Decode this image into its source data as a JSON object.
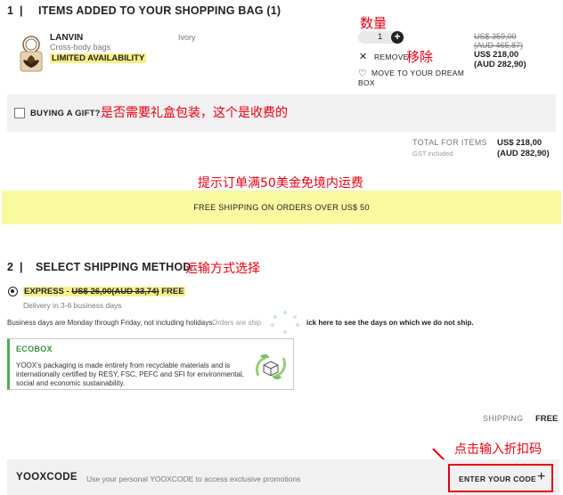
{
  "cart": {
    "step": "1",
    "separator": "|",
    "title": "ITEMS ADDED TO YOUR SHOPPING BAG (1)",
    "item": {
      "brand": "LANVIN",
      "category": "Cross-body bags",
      "color": "Ivory",
      "badge": "LIMITED AVAILABILITY",
      "quantity": "1",
      "remove_label": "REMOVE",
      "move_label": "MOVE TO YOUR DREAM BOX",
      "price_old_usd": "US$ 359,00",
      "price_old_aud": "(AUD 465,87)",
      "price_usd": "US$ 218,00",
      "price_aud": "(AUD 282,90)"
    },
    "gift_label": "BUYING A GIFT?",
    "total_label": "TOTAL FOR ITEMS",
    "total_usd": "US$ 218,00",
    "total_aud": "(AUD 282,90)",
    "gst_note": "GST included"
  },
  "annotations": {
    "quantity": "数量",
    "remove": "移除",
    "gift": "是否需要礼盒包装，这个是收费的",
    "shipping_banner": "提示订单满50美金免境内运费",
    "shipping_method": "运输方式选择",
    "promo": "点击输入折扣码"
  },
  "banner": {
    "text": "FREE SHIPPING ON ORDERS OVER US$ 50"
  },
  "shipping": {
    "step": "2",
    "separator": "|",
    "title": "SELECT SHIPPING METHOD",
    "option_name": "EXPRESS -",
    "option_old_price": "US$ 26,00(AUD 33,74)",
    "option_free": "FREE",
    "delivery": "Delivery in 3-6 business days",
    "note_start": "Business days are Monday through Friday, not including holidays.",
    "note_mid": "Orders are ship",
    "note_link": "ick here to see the days on which we do not ship.",
    "ecobox_title": "ECOBOX",
    "ecobox_text": "YOOX's packaging is made entirely from recyclable materials and is internationally certified by RESY, FSC, PEFC and SFI for environmental, social and economic sustainability.",
    "summary_label": "SHIPPING",
    "summary_value": "FREE"
  },
  "promo": {
    "title": "YOOXCODE",
    "text": "Use your personal YOOXCODE to access exclusive promotions",
    "button": "ENTER YOUR CODE",
    "plus": "+"
  },
  "colors": {
    "annotation_red": "#e60012",
    "highlight_yellow": "#f7f08a",
    "banner_yellow": "#f9f9a0",
    "panel_gray": "#f1f1f1",
    "eco_green": "#4caf50"
  }
}
